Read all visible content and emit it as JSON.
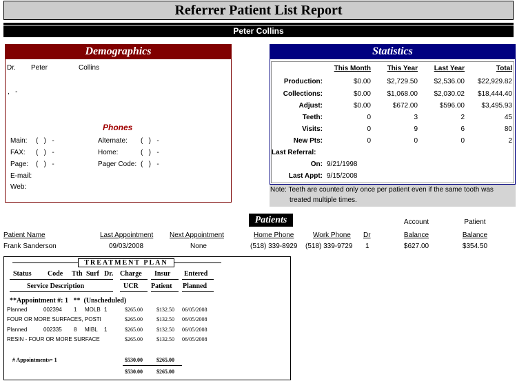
{
  "report": {
    "title": "Referrer Patient List Report",
    "referrer_name": "Peter Collins"
  },
  "demographics": {
    "heading": "Demographics",
    "title": "Dr.",
    "first_name": "Peter",
    "last_name": "Collins",
    "address_line": ",   -",
    "phones_heading": "Phones",
    "main_label": "Main:",
    "main_value": "(   )   -",
    "fax_label": "FAX:",
    "fax_value": "(   )   -",
    "page_label": "Page:",
    "page_value": "(   )   -",
    "email_label": "E-mail:",
    "web_label": "Web:",
    "alternate_label": "Alternate:",
    "alternate_value": "(   )   -",
    "home_label": "Home:",
    "home_value": "(   )   -",
    "pager_label": "Pager Code:",
    "pager_value": "(   )   -"
  },
  "statistics": {
    "heading": "Statistics",
    "columns": [
      "This Month",
      "This Year",
      "Last Year",
      "Total"
    ],
    "rows": [
      {
        "label": "Production:",
        "values": [
          "$0.00",
          "$2,729.50",
          "$2,536.00",
          "$22,929.82"
        ]
      },
      {
        "label": "Collections:",
        "values": [
          "$0.00",
          "$1,068.00",
          "$2,030.02",
          "$18,444.40"
        ]
      },
      {
        "label": "Adjust:",
        "values": [
          "$0.00",
          "$672.00",
          "$596.00",
          "$3,495.93"
        ]
      },
      {
        "label": "Teeth:",
        "values": [
          "0",
          "3",
          "2",
          "45"
        ]
      },
      {
        "label": "Visits:",
        "values": [
          "0",
          "9",
          "6",
          "80"
        ]
      },
      {
        "label": "New Pts:",
        "values": [
          "0",
          "0",
          "0",
          "2"
        ]
      }
    ],
    "last_referral_label": "Last Referral:",
    "on_label": "On:",
    "on_value": "9/21/1998",
    "last_appt_label": "Last Appt:",
    "last_appt_value": "9/15/2008",
    "note_line1": "Note: Teeth are counted only once per patient even if the same tooth was",
    "note_line2": "treated multiple times."
  },
  "patients": {
    "heading": "Patients",
    "account_label": "Account",
    "patient_label": "Patient",
    "columns": {
      "name": "Patient Name",
      "last_appt": "Last Appointment",
      "next_appt": "Next Appointment",
      "home_phone": "Home Phone",
      "work_phone": "Work Phone",
      "dr": "Dr",
      "acct_balance": "Balance",
      "pat_balance": "Balance"
    },
    "rows": [
      {
        "name": "Frank Sanderson",
        "last_appt": "09/03/2008",
        "next_appt": "None",
        "home_phone": "(518) 339-8929",
        "work_phone": "(518) 339-9729",
        "dr": "1",
        "acct_balance": "$627.00",
        "pat_balance": "$354.50"
      }
    ]
  },
  "treatment_plan": {
    "heading": "TREATMENT PLAN",
    "headers_row1": [
      "Status",
      "Code",
      "Tth",
      "Surf",
      "Dr.",
      "Charge",
      "Insur",
      "Entered"
    ],
    "headers_row2": [
      "Service Description",
      "UCR",
      "Patient",
      "Planned"
    ],
    "appointment_heading": "**Appointment #: 1   **  (Unscheduled)",
    "items": [
      {
        "status": "Planned",
        "code": "002394",
        "tooth": "1",
        "surf": "MOLB",
        "dr": "1",
        "charge": "$265.00",
        "insur": "$132.50",
        "entered": "06/05/2008",
        "description": "FOUR OR MORE SURFACES, POSTI",
        "ucr": "$265.00",
        "patient": "$132.50",
        "planned": "06/05/2008"
      },
      {
        "status": "Planned",
        "code": "002335",
        "tooth": "8",
        "surf": "MIBL",
        "dr": "1",
        "charge": "$265.00",
        "insur": "$132.50",
        "entered": "06/05/2008",
        "description": "RESIN - FOUR OR MORE SURFACE",
        "ucr": "$265.00",
        "patient": "$132.50",
        "planned": "06/05/2008"
      }
    ],
    "appointments_label": "# Appointments= 1",
    "subtotal_charge": "$530.00",
    "subtotal_insur": "$265.00",
    "total_charge": "$530.00",
    "total_insur": "$265.00"
  },
  "colors": {
    "demographics_header": "#800000",
    "statistics_header": "#000080",
    "phones_heading": "#a00000",
    "title_bar": "#cccccc",
    "note_bg": "#d4d4d4"
  }
}
